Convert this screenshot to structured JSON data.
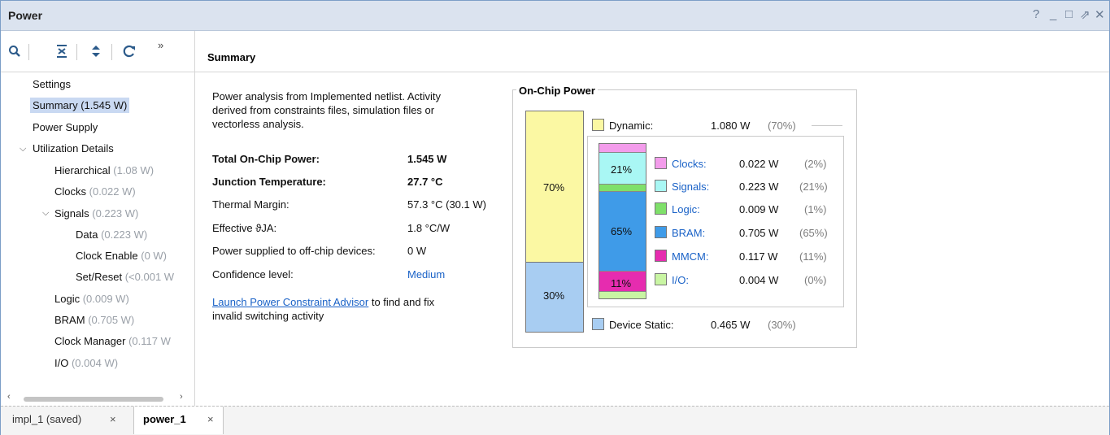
{
  "window": {
    "title": "Power",
    "controls": [
      "?",
      "_",
      "□",
      "⇗",
      "✕"
    ]
  },
  "toolbar": {
    "icons": [
      "search-icon",
      "collapse-all-icon",
      "expand-all-icon",
      "refresh-icon"
    ],
    "more": "»"
  },
  "sidebar": {
    "settings": "Settings",
    "summary": "Summary (1.545 W)",
    "power_supply": "Power Supply",
    "utilization": "Utilization Details",
    "hierarchical": {
      "label": "Hierarchical",
      "value": "(1.08 W)"
    },
    "clocks": {
      "label": "Clocks",
      "value": "(0.022 W)"
    },
    "signals": {
      "label": "Signals",
      "value": "(0.223 W)"
    },
    "data": {
      "label": "Data",
      "value": "(0.223 W)"
    },
    "clock_enable": {
      "label": "Clock Enable",
      "value": "(0 W)"
    },
    "set_reset": {
      "label": "Set/Reset",
      "value": "(<0.001 W"
    },
    "logic": {
      "label": "Logic",
      "value": "(0.009 W)"
    },
    "bram": {
      "label": "BRAM",
      "value": "(0.705 W)"
    },
    "clock_manager": {
      "label": "Clock Manager",
      "value": "(0.117 W"
    },
    "io": {
      "label": "I/O",
      "value": "(0.004 W)"
    }
  },
  "content": {
    "header": "Summary",
    "intro": [
      "Power analysis from Implemented netlist. Activity",
      "derived from constraints files, simulation files or",
      "vectorless analysis."
    ],
    "rows": [
      {
        "label": "Total On-Chip Power:",
        "value": "1.545 W"
      },
      {
        "label": "Junction Temperature:",
        "value": "27.7 °C"
      },
      {
        "label": "Thermal Margin:",
        "value": "57.3 °C (30.1 W)"
      },
      {
        "label": "Effective ϑJA:",
        "value": "1.8 °C/W"
      },
      {
        "label": "Power supplied to off-chip devices:",
        "value": "0 W"
      },
      {
        "label": "Confidence level:",
        "value": "Medium"
      }
    ],
    "advisor_link": "Launch Power Constraint Advisor",
    "advisor_rest": " to find and fix",
    "advisor_line2": "invalid switching activity"
  },
  "onchip": {
    "title": "On-Chip Power",
    "outer": {
      "dynamic_pct": "70%",
      "static_pct": "30%"
    },
    "dynamic": {
      "label": "Dynamic:",
      "value": "1.080 W",
      "pct": "(70%)"
    },
    "inner_pcts": {
      "signals": "21%",
      "bram": "65%",
      "mmcm": "11%"
    },
    "items": [
      {
        "label": "Clocks",
        "value": "0.022 W",
        "pct": "(2%)",
        "color": "#f39ceb"
      },
      {
        "label": "Signals",
        "value": "0.223 W",
        "pct": "(21%)",
        "color": "#a9f7f4"
      },
      {
        "label": "Logic",
        "value": "0.009 W",
        "pct": "(1%)",
        "color": "#7fe06a"
      },
      {
        "label": "BRAM",
        "value": "0.705 W",
        "pct": "(65%)",
        "color": "#3f9be8"
      },
      {
        "label": "MMCM",
        "value": "0.117 W",
        "pct": "(11%)",
        "color": "#e62caf"
      },
      {
        "label": "I/O",
        "value": "0.004 W",
        "pct": "(0%)",
        "color": "#c9f5a3"
      }
    ],
    "static": {
      "label": "Device Static:",
      "value": "0.465 W",
      "pct": "(30%)"
    }
  },
  "tabs": [
    {
      "label": "impl_1 (saved)",
      "close": "×"
    },
    {
      "label": "power_1",
      "close": "×"
    }
  ]
}
